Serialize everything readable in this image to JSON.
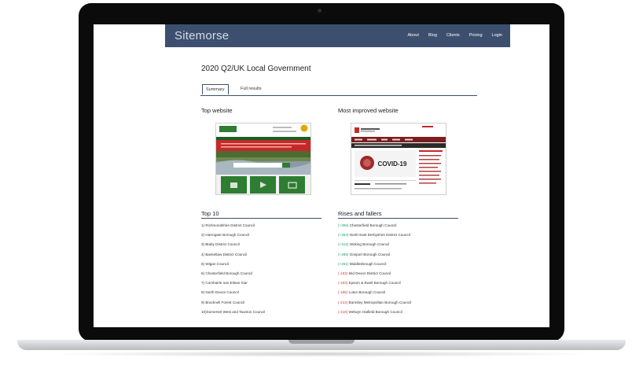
{
  "site": {
    "logo": "Sitemorse",
    "nav": [
      "About",
      "Blog",
      "Clients",
      "Pricing",
      "Login"
    ]
  },
  "page_title": "2020 Q2/UK Local Government",
  "tabs": [
    {
      "label": "Summary",
      "active": true
    },
    {
      "label": "Full results",
      "active": false
    }
  ],
  "top_website": {
    "title": "Top website"
  },
  "most_improved": {
    "title": "Most improved website",
    "banner_text": "COVID-19"
  },
  "top10": {
    "title": "Top 10",
    "items": [
      "1)  Richmondshire District Council",
      "2)  Harrogate Borough Council",
      "3)  Blaby District Council",
      "4)  Bassetlaw District Council",
      "5)  Wigan Council",
      "6)  Chesterfield Borough Council",
      "7)  Comhairle nan Eilean Siar",
      "8)  North Devon Council",
      "9)  Bracknell Forest Council",
      "10)Somerset West and Taunton Council"
    ]
  },
  "rises_fallers": {
    "title": "Rises and fallers",
    "items": [
      {
        "change": "(+355)",
        "name": "Chesterfield Borough Council",
        "direction": "up"
      },
      {
        "change": "(+364)",
        "name": "North East Derbyshire District Council",
        "direction": "up"
      },
      {
        "change": "(+312)",
        "name": "Woking Borough Council",
        "direction": "up"
      },
      {
        "change": "(+285)",
        "name": "Gosport Borough Council",
        "direction": "up"
      },
      {
        "change": "(+261)",
        "name": "Middlesbrough Council",
        "direction": "up"
      },
      {
        "change": "(-183)",
        "name": "Mid Devon District Council",
        "direction": "down"
      },
      {
        "change": "(-183)",
        "name": "Epsom & Ewell Borough Council",
        "direction": "down"
      },
      {
        "change": "(-186)",
        "name": "Luton Borough Council",
        "direction": "down"
      },
      {
        "change": "(-213)",
        "name": "Barnsley Metropolitan Borough Council",
        "direction": "down"
      },
      {
        "change": "(-218)",
        "name": "Welwyn Hatfield Borough Council",
        "direction": "down"
      }
    ]
  },
  "colors": {
    "header": "#3d4f6e",
    "rise": "#1d9b6a",
    "fall": "#d03a3a"
  }
}
